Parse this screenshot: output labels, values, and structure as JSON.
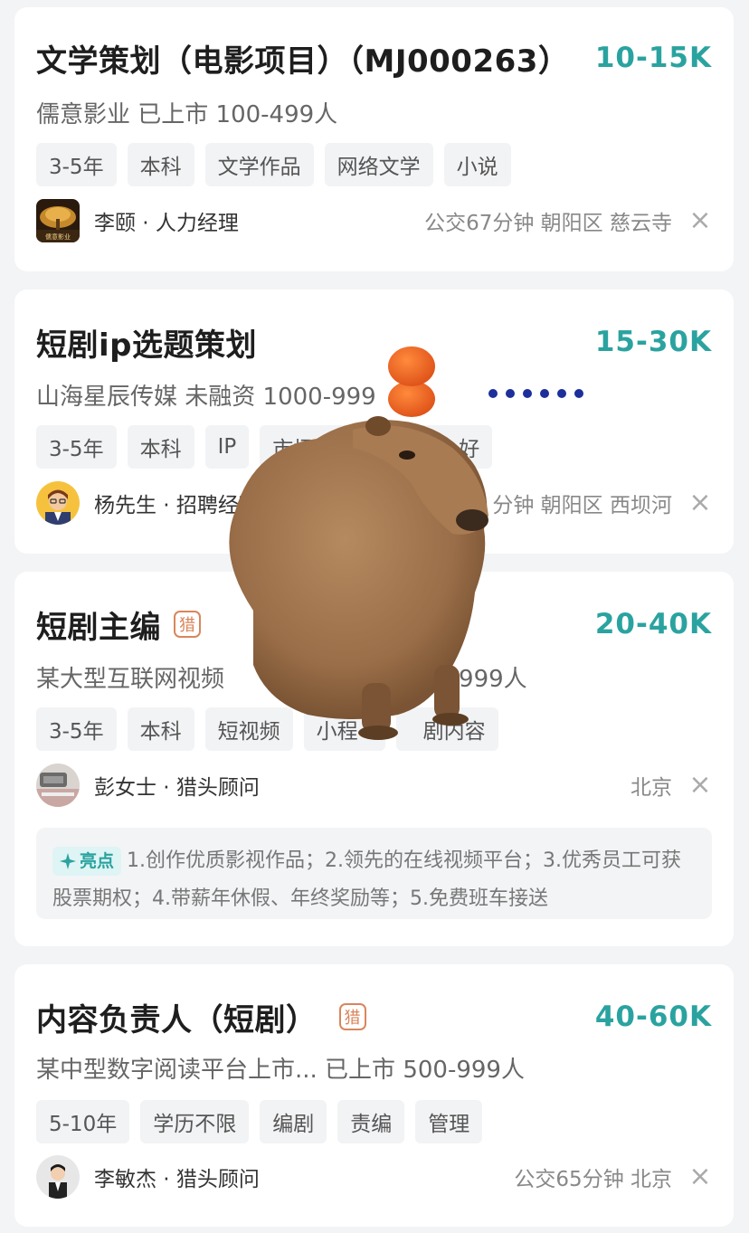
{
  "jobs": [
    {
      "title": "文学策划（电影项目）（MJ000263）",
      "salary": "10-15K",
      "company": "儒意影业 已上市 100-499人",
      "tags": [
        "3-5年",
        "本科",
        "文学作品",
        "网络文学",
        "小说"
      ],
      "recruiter": "李颐 · 人力经理",
      "location": "公交67分钟 朝阳区 慈云寺"
    },
    {
      "title": "短剧ip选题策划",
      "salary": "15-30K",
      "company": "山海星辰传媒 未融资 1000-999",
      "tags": [
        "3-5年",
        "本科",
        "IP",
        "市场",
        "好"
      ],
      "recruiter": "杨先生 · 招聘经理",
      "location": "分钟 朝阳区 西坝河"
    },
    {
      "title": "短剧主编",
      "hunt_badge": "猎",
      "salary": "20-40K",
      "company": "某大型互联网视频",
      "company_tail": "00-9999人",
      "tags": [
        "3-5年",
        "本科",
        "短视频",
        "小程",
        "剧内容"
      ],
      "recruiter": "彭女士 · 猎头顾问",
      "location": "北京",
      "highlight_label": "亮点",
      "highlight_text": "1.创作优质影视作品；2.领先的在线视频平台；3.优秀员工可获股票期权；4.带薪年休假、年终奖励等；5.免费班车接送"
    },
    {
      "title": "内容负责人（短剧）",
      "hunt_badge": "猎",
      "salary": "40-60K",
      "company": "某中型数字阅读平台上市... 已上市 500-999人",
      "tags": [
        "5-10年",
        "学历不限",
        "编剧",
        "责编",
        "管理"
      ],
      "recruiter": "李敏杰 · 猎头顾问",
      "location": "公交65分钟 北京"
    }
  ],
  "avatar_logo_text": "儒意影业",
  "close_icon": "×",
  "colors": {
    "salary": "#2aa3a0",
    "hunt_badge": "#d9865b",
    "marker": "#faf28c"
  }
}
